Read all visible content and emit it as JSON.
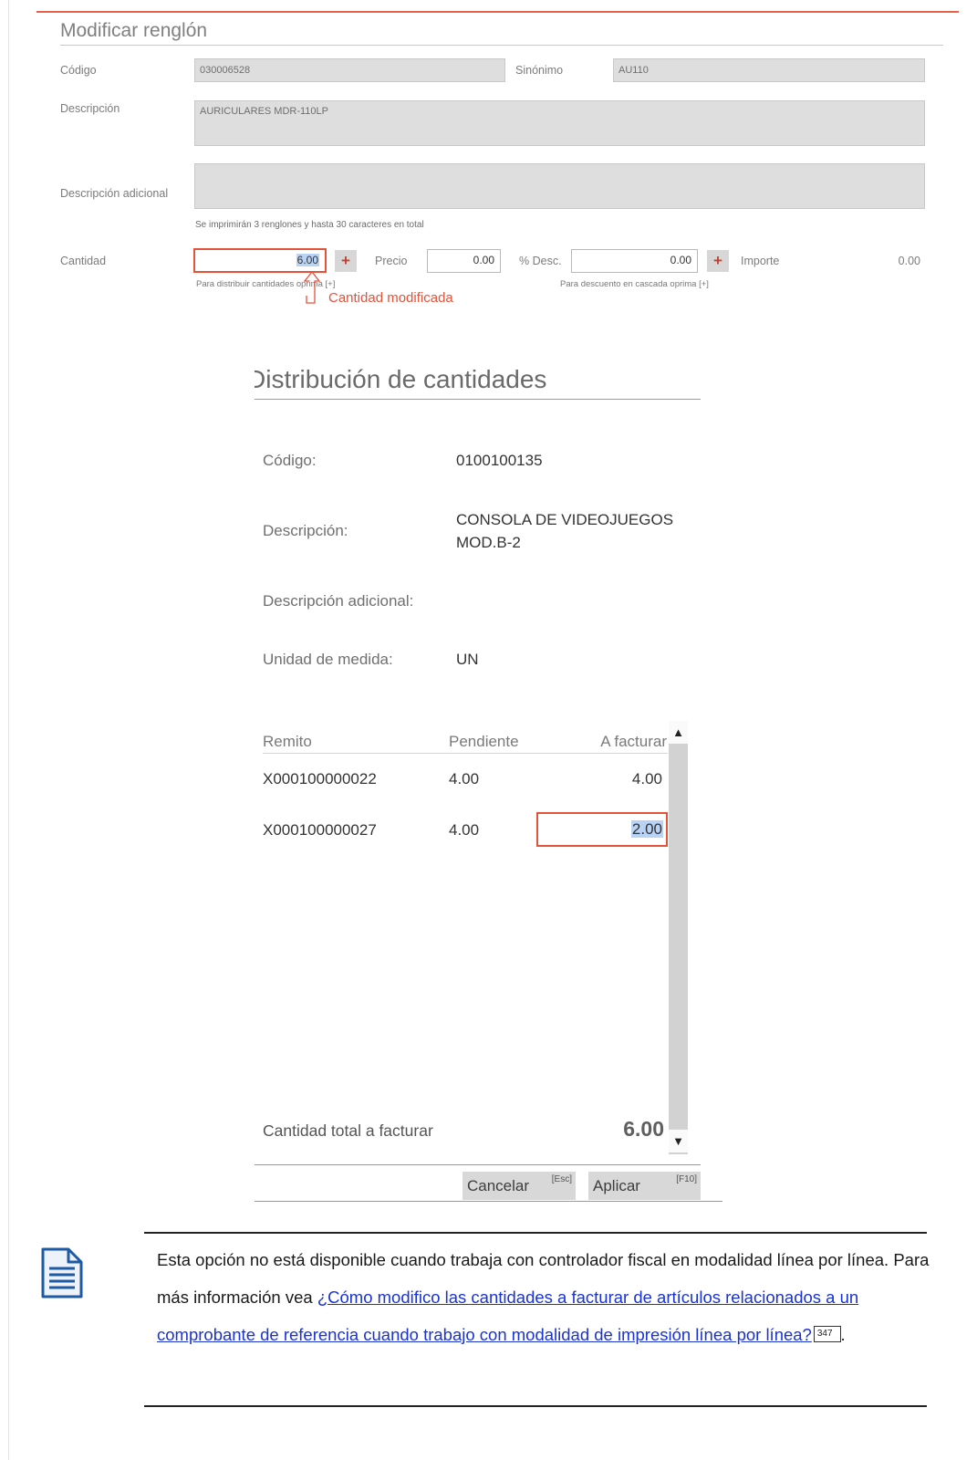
{
  "modificar": {
    "title": "Modificar renglón",
    "codigo_label": "Código",
    "codigo_value": "030006528",
    "sinonimo_label": "Sinónimo",
    "sinonimo_value": "AU110",
    "descripcion_label": "Descripción",
    "descripcion_value": "AURICULARES MDR-110LP",
    "desc_adicional_label": "Descripción adicional",
    "desc_adicional_value": "",
    "print_hint": "Se imprimirán 3 renglones y hasta 30 caracteres en total",
    "cantidad_label": "Cantidad",
    "cantidad_value": "6.00",
    "precio_label": "Precio",
    "precio_value": "0.00",
    "desc_label": "% Desc.",
    "desc_value": "0.00",
    "importe_label": "Importe",
    "importe_value": "0.00",
    "plus_label": "+",
    "cantidad_hint": "Para distribuir cantidades oprima [+]",
    "descuento_hint": "Para descuento en cascada oprima [+]",
    "annotation": "Cantidad modificada"
  },
  "distribucion": {
    "title": "Distribución de cantidades",
    "codigo_label": "Código:",
    "codigo_value": "0100100135",
    "descripcion_label": "Descripción:",
    "descripcion_line1": "CONSOLA DE VIDEOJUEGOS",
    "descripcion_line2": "MOD.B-2",
    "desc_adicional_label": "Descripción adicional:",
    "unidad_label": "Unidad de medida:",
    "unidad_value": "UN",
    "table": {
      "headers": [
        "Remito",
        "Pendiente",
        "A facturar"
      ],
      "rows": [
        {
          "remito": "X000100000022",
          "pendiente": "4.00",
          "a_facturar": "4.00"
        },
        {
          "remito": "X000100000027",
          "pendiente": "4.00",
          "a_facturar": "2.00"
        }
      ]
    },
    "total_label": "Cantidad total a facturar",
    "total_value": "6.00",
    "scroll_up": "▲",
    "scroll_down": "▼",
    "cancel_label": "Cancelar",
    "cancel_key": "[Esc]",
    "apply_label": "Aplicar",
    "apply_key": "[F10]"
  },
  "note": {
    "text_before": "Esta opción no está disponible cuando trabaja con controlador fiscal en modalidad línea por línea. Para más información vea ",
    "link": "¿Cómo modifico las cantidades a facturar de artículos relacionados a un comprobante de referencia cuando trabajo con modalidad de impresión línea por línea?",
    "page_ref": "347",
    "text_after": "."
  },
  "colors": {
    "accent": "#e8614b",
    "link": "#1a33d4",
    "selection": "#b8d3f5",
    "note_icon": "#1f5aa5"
  }
}
